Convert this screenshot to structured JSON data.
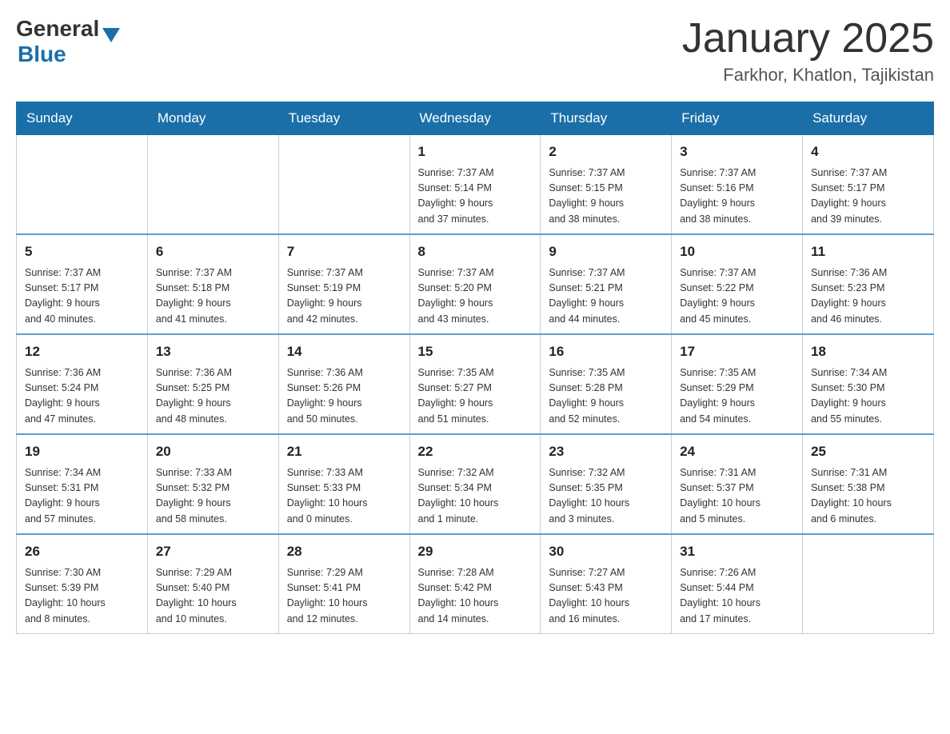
{
  "header": {
    "logo": {
      "general": "General",
      "triangle": "▲",
      "blue": "Blue"
    },
    "title": "January 2025",
    "subtitle": "Farkhor, Khatlon, Tajikistan"
  },
  "calendar": {
    "days": [
      "Sunday",
      "Monday",
      "Tuesday",
      "Wednesday",
      "Thursday",
      "Friday",
      "Saturday"
    ],
    "weeks": [
      [
        {
          "day": "",
          "info": ""
        },
        {
          "day": "",
          "info": ""
        },
        {
          "day": "",
          "info": ""
        },
        {
          "day": "1",
          "info": "Sunrise: 7:37 AM\nSunset: 5:14 PM\nDaylight: 9 hours\nand 37 minutes."
        },
        {
          "day": "2",
          "info": "Sunrise: 7:37 AM\nSunset: 5:15 PM\nDaylight: 9 hours\nand 38 minutes."
        },
        {
          "day": "3",
          "info": "Sunrise: 7:37 AM\nSunset: 5:16 PM\nDaylight: 9 hours\nand 38 minutes."
        },
        {
          "day": "4",
          "info": "Sunrise: 7:37 AM\nSunset: 5:17 PM\nDaylight: 9 hours\nand 39 minutes."
        }
      ],
      [
        {
          "day": "5",
          "info": "Sunrise: 7:37 AM\nSunset: 5:17 PM\nDaylight: 9 hours\nand 40 minutes."
        },
        {
          "day": "6",
          "info": "Sunrise: 7:37 AM\nSunset: 5:18 PM\nDaylight: 9 hours\nand 41 minutes."
        },
        {
          "day": "7",
          "info": "Sunrise: 7:37 AM\nSunset: 5:19 PM\nDaylight: 9 hours\nand 42 minutes."
        },
        {
          "day": "8",
          "info": "Sunrise: 7:37 AM\nSunset: 5:20 PM\nDaylight: 9 hours\nand 43 minutes."
        },
        {
          "day": "9",
          "info": "Sunrise: 7:37 AM\nSunset: 5:21 PM\nDaylight: 9 hours\nand 44 minutes."
        },
        {
          "day": "10",
          "info": "Sunrise: 7:37 AM\nSunset: 5:22 PM\nDaylight: 9 hours\nand 45 minutes."
        },
        {
          "day": "11",
          "info": "Sunrise: 7:36 AM\nSunset: 5:23 PM\nDaylight: 9 hours\nand 46 minutes."
        }
      ],
      [
        {
          "day": "12",
          "info": "Sunrise: 7:36 AM\nSunset: 5:24 PM\nDaylight: 9 hours\nand 47 minutes."
        },
        {
          "day": "13",
          "info": "Sunrise: 7:36 AM\nSunset: 5:25 PM\nDaylight: 9 hours\nand 48 minutes."
        },
        {
          "day": "14",
          "info": "Sunrise: 7:36 AM\nSunset: 5:26 PM\nDaylight: 9 hours\nand 50 minutes."
        },
        {
          "day": "15",
          "info": "Sunrise: 7:35 AM\nSunset: 5:27 PM\nDaylight: 9 hours\nand 51 minutes."
        },
        {
          "day": "16",
          "info": "Sunrise: 7:35 AM\nSunset: 5:28 PM\nDaylight: 9 hours\nand 52 minutes."
        },
        {
          "day": "17",
          "info": "Sunrise: 7:35 AM\nSunset: 5:29 PM\nDaylight: 9 hours\nand 54 minutes."
        },
        {
          "day": "18",
          "info": "Sunrise: 7:34 AM\nSunset: 5:30 PM\nDaylight: 9 hours\nand 55 minutes."
        }
      ],
      [
        {
          "day": "19",
          "info": "Sunrise: 7:34 AM\nSunset: 5:31 PM\nDaylight: 9 hours\nand 57 minutes."
        },
        {
          "day": "20",
          "info": "Sunrise: 7:33 AM\nSunset: 5:32 PM\nDaylight: 9 hours\nand 58 minutes."
        },
        {
          "day": "21",
          "info": "Sunrise: 7:33 AM\nSunset: 5:33 PM\nDaylight: 10 hours\nand 0 minutes."
        },
        {
          "day": "22",
          "info": "Sunrise: 7:32 AM\nSunset: 5:34 PM\nDaylight: 10 hours\nand 1 minute."
        },
        {
          "day": "23",
          "info": "Sunrise: 7:32 AM\nSunset: 5:35 PM\nDaylight: 10 hours\nand 3 minutes."
        },
        {
          "day": "24",
          "info": "Sunrise: 7:31 AM\nSunset: 5:37 PM\nDaylight: 10 hours\nand 5 minutes."
        },
        {
          "day": "25",
          "info": "Sunrise: 7:31 AM\nSunset: 5:38 PM\nDaylight: 10 hours\nand 6 minutes."
        }
      ],
      [
        {
          "day": "26",
          "info": "Sunrise: 7:30 AM\nSunset: 5:39 PM\nDaylight: 10 hours\nand 8 minutes."
        },
        {
          "day": "27",
          "info": "Sunrise: 7:29 AM\nSunset: 5:40 PM\nDaylight: 10 hours\nand 10 minutes."
        },
        {
          "day": "28",
          "info": "Sunrise: 7:29 AM\nSunset: 5:41 PM\nDaylight: 10 hours\nand 12 minutes."
        },
        {
          "day": "29",
          "info": "Sunrise: 7:28 AM\nSunset: 5:42 PM\nDaylight: 10 hours\nand 14 minutes."
        },
        {
          "day": "30",
          "info": "Sunrise: 7:27 AM\nSunset: 5:43 PM\nDaylight: 10 hours\nand 16 minutes."
        },
        {
          "day": "31",
          "info": "Sunrise: 7:26 AM\nSunset: 5:44 PM\nDaylight: 10 hours\nand 17 minutes."
        },
        {
          "day": "",
          "info": ""
        }
      ]
    ]
  }
}
